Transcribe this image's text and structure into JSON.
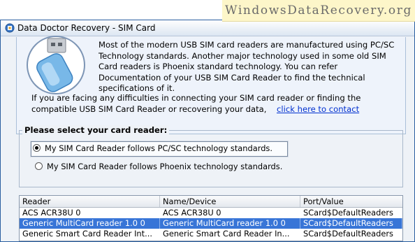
{
  "watermark": "WindowsDataRecovery.org",
  "window": {
    "title": "Data Doctor Recovery - SIM Card"
  },
  "info": {
    "paragraph1": "Most of the modern USB SIM card readers are manufactured using PC/SC Technology standards. Another major technology used in some old SIM Card readers is Phoenix standard technology. You can refer Documentation of your USB SIM Card Reader to find the technical specifications of it.",
    "paragraph2": "If you are facing any difficulties in connecting your SIM card reader or finding the compatible USB SIM Card Reader or recovering your data,",
    "contact_link": "click here to contact"
  },
  "reader_select": {
    "legend": "Please select your card reader:",
    "option_pcsc": "My SIM Card Reader follows PC/SC technology standards.",
    "option_phoenix": "My SIM Card Reader follows Phoenix technology standards.",
    "selected": "pcsc"
  },
  "table": {
    "columns": [
      "Reader",
      "Name/Device",
      "Port/Value"
    ],
    "rows": [
      [
        "ACS ACR38U 0",
        "ACS ACR38U 0",
        "SCard$DefaultReaders"
      ],
      [
        "Generic MultiCard reader 1.0 0",
        "Generic MultiCard reader 1.0 0",
        "SCard$DefaultReaders"
      ],
      [
        "Generic Smart Card Reader Int...",
        "Generic Smart Card Reader In...",
        "SCard$DefaultReaders"
      ]
    ],
    "selected_row": 1
  },
  "colors": {
    "selection": "#3875d7",
    "link": "#0030d0",
    "watermark_bg": "#fdf6c9"
  }
}
